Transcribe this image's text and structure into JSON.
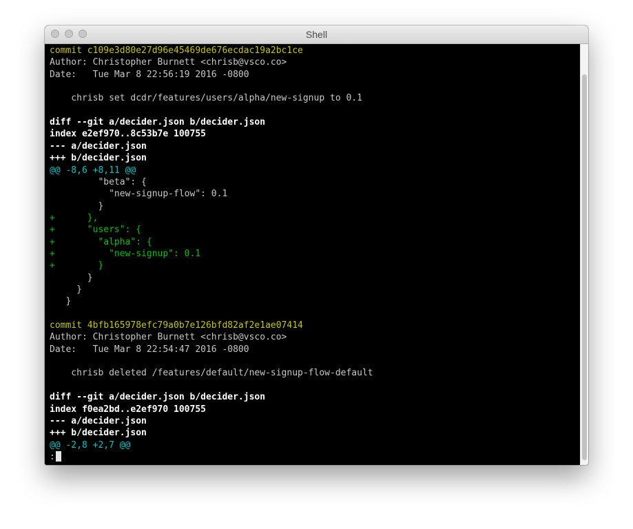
{
  "window": {
    "title": "Shell"
  },
  "terminal": {
    "lines": [
      {
        "text": "commit c109e3d80e27d96e45469de676ecdac19a2bc1ce",
        "style": "yellow"
      },
      {
        "text": "Author: Christopher Burnett <chrisb@vsco.co>",
        "style": "plain"
      },
      {
        "text": "Date:   Tue Mar 8 22:56:19 2016 -0800",
        "style": "plain"
      },
      {
        "text": "",
        "style": "plain"
      },
      {
        "text": "    chrisb set dcdr/features/users/alpha/new-signup to 0.1",
        "style": "plain"
      },
      {
        "text": "",
        "style": "plain"
      },
      {
        "text": "diff --git a/decider.json b/decider.json",
        "style": "bold"
      },
      {
        "text": "index e2ef970..8c53b7e 100755",
        "style": "bold"
      },
      {
        "text": "--- a/decider.json",
        "style": "bold"
      },
      {
        "text": "+++ b/decider.json",
        "style": "bold"
      },
      {
        "text": "@@ -8,6 +8,11 @@",
        "style": "cyan"
      },
      {
        "text": "         \"beta\": {",
        "style": "plain"
      },
      {
        "text": "           \"new-signup-flow\": 0.1",
        "style": "plain"
      },
      {
        "text": "         }",
        "style": "plain"
      },
      {
        "text": "+      },",
        "style": "green"
      },
      {
        "text": "+      \"users\": {",
        "style": "green"
      },
      {
        "text": "+        \"alpha\": {",
        "style": "green"
      },
      {
        "text": "+          \"new-signup\": 0.1",
        "style": "green"
      },
      {
        "text": "+        }",
        "style": "green"
      },
      {
        "text": "       }",
        "style": "plain"
      },
      {
        "text": "     }",
        "style": "plain"
      },
      {
        "text": "   }",
        "style": "plain"
      },
      {
        "text": "",
        "style": "plain"
      },
      {
        "text": "commit 4bfb165978efc79a0b7e126bfd82af2e1ae07414",
        "style": "yellow"
      },
      {
        "text": "Author: Christopher Burnett <chrisb@vsco.co>",
        "style": "plain"
      },
      {
        "text": "Date:   Tue Mar 8 22:54:47 2016 -0800",
        "style": "plain"
      },
      {
        "text": "",
        "style": "plain"
      },
      {
        "text": "    chrisb deleted /features/default/new-signup-flow-default",
        "style": "plain"
      },
      {
        "text": "",
        "style": "plain"
      },
      {
        "text": "diff --git a/decider.json b/decider.json",
        "style": "bold"
      },
      {
        "text": "index f0ea2bd..e2ef970 100755",
        "style": "bold"
      },
      {
        "text": "--- a/decider.json",
        "style": "bold"
      },
      {
        "text": "+++ b/decider.json",
        "style": "bold"
      },
      {
        "text": "@@ -2,8 +2,7 @@",
        "style": "cyan"
      }
    ],
    "prompt": ":"
  }
}
